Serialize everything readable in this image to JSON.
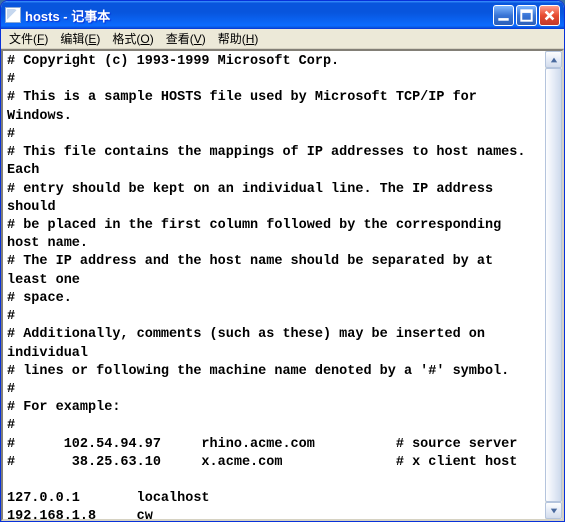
{
  "window": {
    "title": "hosts - 记事本"
  },
  "menu": {
    "file": "文件(F)",
    "edit": "编辑(E)",
    "format": "格式(O)",
    "view": "查看(V)",
    "help": "帮助(H)"
  },
  "editor": {
    "content": "# Copyright (c) 1993-1999 Microsoft Corp.\n#\n# This is a sample HOSTS file used by Microsoft TCP/IP for Windows.\n#\n# This file contains the mappings of IP addresses to host names. Each\n# entry should be kept on an individual line. The IP address should\n# be placed in the first column followed by the corresponding host name.\n# The IP address and the host name should be separated by at least one\n# space.\n#\n# Additionally, comments (such as these) may be inserted on individual\n# lines or following the machine name denoted by a '#' symbol.\n#\n# For example:\n#\n#      102.54.94.97     rhino.acme.com          # source server\n#       38.25.63.10     x.acme.com              # x client host\n\n127.0.0.1       localhost\n192.168.1.8     cw"
  }
}
